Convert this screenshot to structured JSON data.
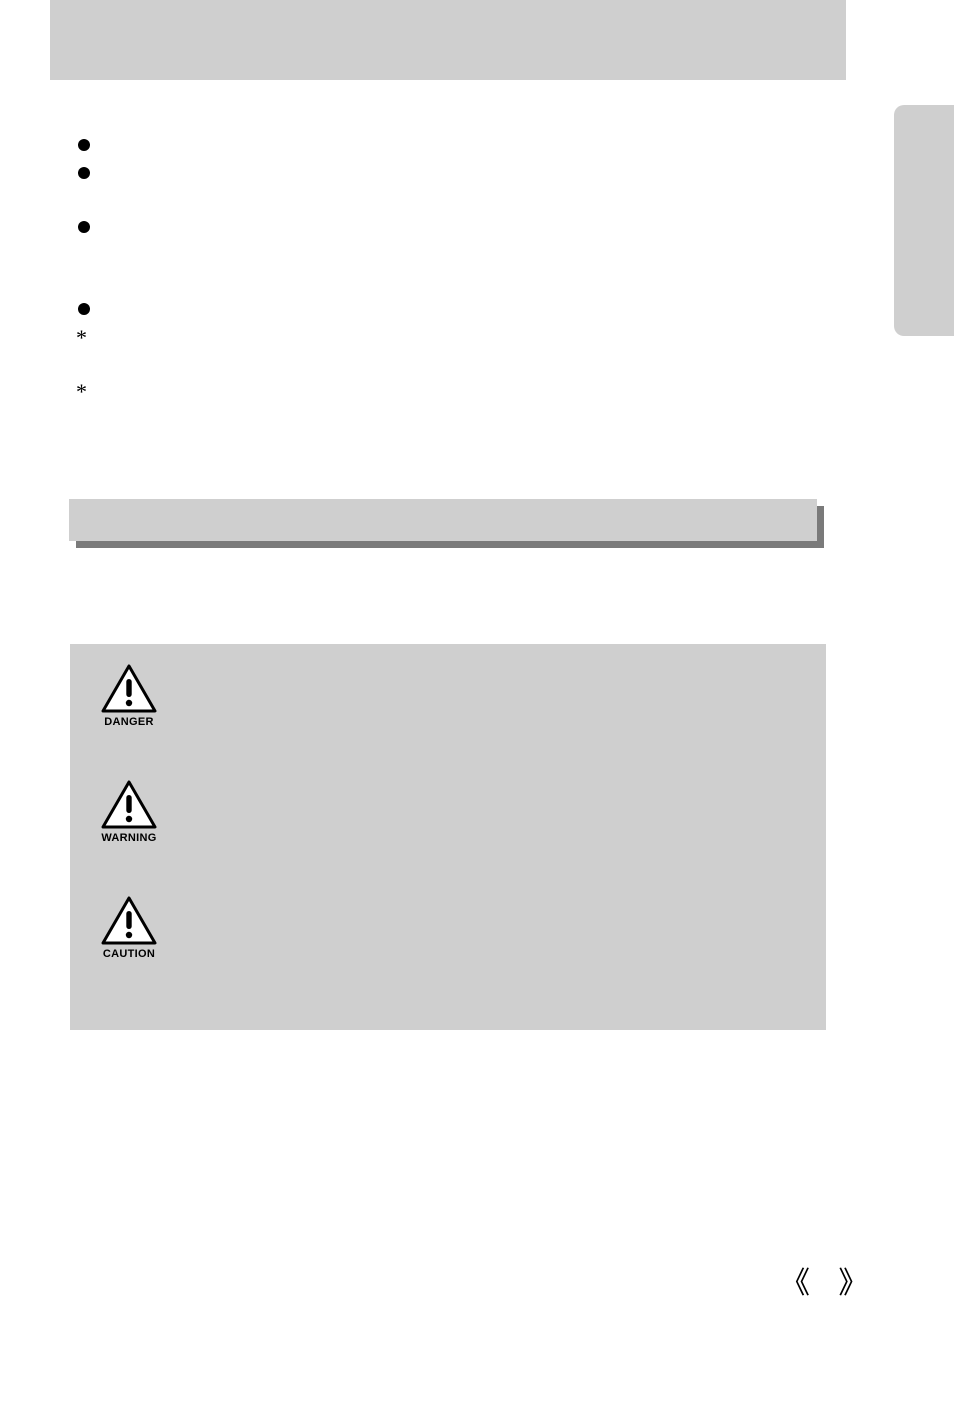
{
  "top_banner": {
    "title": ""
  },
  "side_tab": {
    "label": ""
  },
  "intro_list": {
    "items": [
      {
        "marker": "bullet",
        "text": ""
      },
      {
        "marker": "bullet",
        "text": ""
      },
      {
        "marker": "bullet",
        "text": ""
      },
      {
        "marker": "bullet",
        "text": ""
      },
      {
        "marker": "asterisk",
        "text": ""
      },
      {
        "marker": "asterisk",
        "text": ""
      }
    ]
  },
  "section_bar": {
    "title": ""
  },
  "warn_panel": {
    "items": [
      {
        "label": "DANGER",
        "description": ""
      },
      {
        "label": "WARNING",
        "description": ""
      },
      {
        "label": "CAUTION",
        "description": ""
      }
    ]
  },
  "footer": {
    "guillemets": "《   》"
  }
}
